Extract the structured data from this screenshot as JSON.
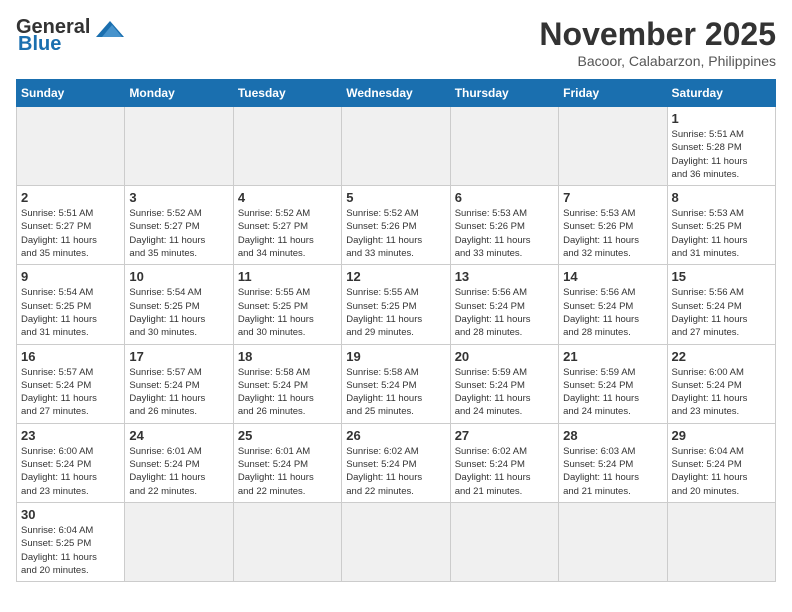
{
  "header": {
    "logo_general": "General",
    "logo_blue": "Blue",
    "month_title": "November 2025",
    "location": "Bacoor, Calabarzon, Philippines"
  },
  "weekdays": [
    "Sunday",
    "Monday",
    "Tuesday",
    "Wednesday",
    "Thursday",
    "Friday",
    "Saturday"
  ],
  "days": [
    {
      "date": "",
      "info": ""
    },
    {
      "date": "",
      "info": ""
    },
    {
      "date": "",
      "info": ""
    },
    {
      "date": "",
      "info": ""
    },
    {
      "date": "",
      "info": ""
    },
    {
      "date": "",
      "info": ""
    },
    {
      "date": "1",
      "info": "Sunrise: 5:51 AM\nSunset: 5:28 PM\nDaylight: 11 hours\nand 36 minutes."
    },
    {
      "date": "2",
      "info": "Sunrise: 5:51 AM\nSunset: 5:27 PM\nDaylight: 11 hours\nand 35 minutes."
    },
    {
      "date": "3",
      "info": "Sunrise: 5:52 AM\nSunset: 5:27 PM\nDaylight: 11 hours\nand 35 minutes."
    },
    {
      "date": "4",
      "info": "Sunrise: 5:52 AM\nSunset: 5:27 PM\nDaylight: 11 hours\nand 34 minutes."
    },
    {
      "date": "5",
      "info": "Sunrise: 5:52 AM\nSunset: 5:26 PM\nDaylight: 11 hours\nand 33 minutes."
    },
    {
      "date": "6",
      "info": "Sunrise: 5:53 AM\nSunset: 5:26 PM\nDaylight: 11 hours\nand 33 minutes."
    },
    {
      "date": "7",
      "info": "Sunrise: 5:53 AM\nSunset: 5:26 PM\nDaylight: 11 hours\nand 32 minutes."
    },
    {
      "date": "8",
      "info": "Sunrise: 5:53 AM\nSunset: 5:25 PM\nDaylight: 11 hours\nand 31 minutes."
    },
    {
      "date": "9",
      "info": "Sunrise: 5:54 AM\nSunset: 5:25 PM\nDaylight: 11 hours\nand 31 minutes."
    },
    {
      "date": "10",
      "info": "Sunrise: 5:54 AM\nSunset: 5:25 PM\nDaylight: 11 hours\nand 30 minutes."
    },
    {
      "date": "11",
      "info": "Sunrise: 5:55 AM\nSunset: 5:25 PM\nDaylight: 11 hours\nand 30 minutes."
    },
    {
      "date": "12",
      "info": "Sunrise: 5:55 AM\nSunset: 5:25 PM\nDaylight: 11 hours\nand 29 minutes."
    },
    {
      "date": "13",
      "info": "Sunrise: 5:56 AM\nSunset: 5:24 PM\nDaylight: 11 hours\nand 28 minutes."
    },
    {
      "date": "14",
      "info": "Sunrise: 5:56 AM\nSunset: 5:24 PM\nDaylight: 11 hours\nand 28 minutes."
    },
    {
      "date": "15",
      "info": "Sunrise: 5:56 AM\nSunset: 5:24 PM\nDaylight: 11 hours\nand 27 minutes."
    },
    {
      "date": "16",
      "info": "Sunrise: 5:57 AM\nSunset: 5:24 PM\nDaylight: 11 hours\nand 27 minutes."
    },
    {
      "date": "17",
      "info": "Sunrise: 5:57 AM\nSunset: 5:24 PM\nDaylight: 11 hours\nand 26 minutes."
    },
    {
      "date": "18",
      "info": "Sunrise: 5:58 AM\nSunset: 5:24 PM\nDaylight: 11 hours\nand 26 minutes."
    },
    {
      "date": "19",
      "info": "Sunrise: 5:58 AM\nSunset: 5:24 PM\nDaylight: 11 hours\nand 25 minutes."
    },
    {
      "date": "20",
      "info": "Sunrise: 5:59 AM\nSunset: 5:24 PM\nDaylight: 11 hours\nand 24 minutes."
    },
    {
      "date": "21",
      "info": "Sunrise: 5:59 AM\nSunset: 5:24 PM\nDaylight: 11 hours\nand 24 minutes."
    },
    {
      "date": "22",
      "info": "Sunrise: 6:00 AM\nSunset: 5:24 PM\nDaylight: 11 hours\nand 23 minutes."
    },
    {
      "date": "23",
      "info": "Sunrise: 6:00 AM\nSunset: 5:24 PM\nDaylight: 11 hours\nand 23 minutes."
    },
    {
      "date": "24",
      "info": "Sunrise: 6:01 AM\nSunset: 5:24 PM\nDaylight: 11 hours\nand 22 minutes."
    },
    {
      "date": "25",
      "info": "Sunrise: 6:01 AM\nSunset: 5:24 PM\nDaylight: 11 hours\nand 22 minutes."
    },
    {
      "date": "26",
      "info": "Sunrise: 6:02 AM\nSunset: 5:24 PM\nDaylight: 11 hours\nand 22 minutes."
    },
    {
      "date": "27",
      "info": "Sunrise: 6:02 AM\nSunset: 5:24 PM\nDaylight: 11 hours\nand 21 minutes."
    },
    {
      "date": "28",
      "info": "Sunrise: 6:03 AM\nSunset: 5:24 PM\nDaylight: 11 hours\nand 21 minutes."
    },
    {
      "date": "29",
      "info": "Sunrise: 6:04 AM\nSunset: 5:24 PM\nDaylight: 11 hours\nand 20 minutes."
    },
    {
      "date": "30",
      "info": "Sunrise: 6:04 AM\nSunset: 5:25 PM\nDaylight: 11 hours\nand 20 minutes."
    },
    {
      "date": "",
      "info": ""
    },
    {
      "date": "",
      "info": ""
    },
    {
      "date": "",
      "info": ""
    },
    {
      "date": "",
      "info": ""
    },
    {
      "date": "",
      "info": ""
    },
    {
      "date": "",
      "info": ""
    }
  ]
}
